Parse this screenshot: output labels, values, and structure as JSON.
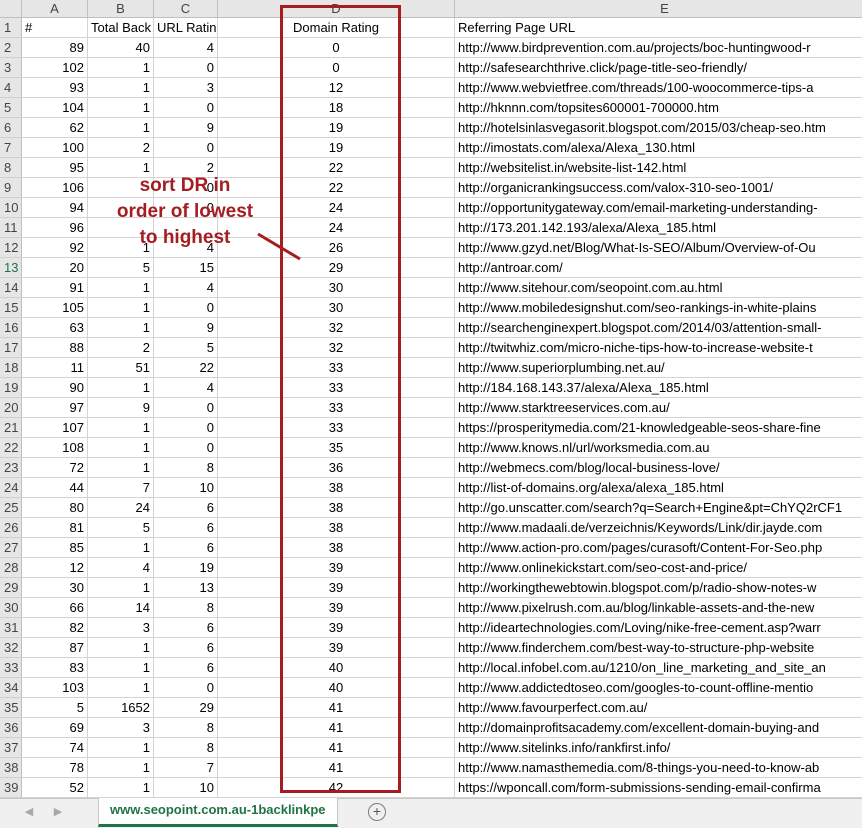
{
  "columns": [
    "A",
    "B",
    "C",
    "D",
    "E"
  ],
  "header_row": {
    "row_number": "1",
    "cells": [
      "#",
      "Total Back",
      "URL Rating",
      "Domain Rating",
      "Referring Page URL"
    ]
  },
  "rows": [
    {
      "n": "2",
      "a": "89",
      "b": "40",
      "c": "4",
      "d": "0",
      "e": "http://www.birdprevention.com.au/projects/boc-huntingwood-r"
    },
    {
      "n": "3",
      "a": "102",
      "b": "1",
      "c": "0",
      "d": "0",
      "e": "http://safesearchthrive.click/page-title-seo-friendly/"
    },
    {
      "n": "4",
      "a": "93",
      "b": "1",
      "c": "3",
      "d": "12",
      "e": "http://www.webvietfree.com/threads/100-woocommerce-tips-a"
    },
    {
      "n": "5",
      "a": "104",
      "b": "1",
      "c": "0",
      "d": "18",
      "e": "http://hknnn.com/topsites600001-700000.htm"
    },
    {
      "n": "6",
      "a": "62",
      "b": "1",
      "c": "9",
      "d": "19",
      "e": "http://hotelsinlasvegasorit.blogspot.com/2015/03/cheap-seo.htm"
    },
    {
      "n": "7",
      "a": "100",
      "b": "2",
      "c": "0",
      "d": "19",
      "e": "http://imostats.com/alexa/Alexa_130.html"
    },
    {
      "n": "8",
      "a": "95",
      "b": "1",
      "c": "2",
      "d": "22",
      "e": "http://websitelist.in/website-list-142.html"
    },
    {
      "n": "9",
      "a": "106",
      "b": "",
      "c": "0",
      "d": "22",
      "e": "http://organicrankingsuccess.com/valox-310-seo-1001/"
    },
    {
      "n": "10",
      "a": "94",
      "b": "",
      "c": "0",
      "d": "24",
      "e": "http://opportunitygateway.com/email-marketing-understanding-"
    },
    {
      "n": "11",
      "a": "96",
      "b": "",
      "c": "",
      "d": "24",
      "e": "http://173.201.142.193/alexa/Alexa_185.html"
    },
    {
      "n": "12",
      "a": "92",
      "b": "1",
      "c": "4",
      "d": "26",
      "e": "http://www.gzyd.net/Blog/What-Is-SEO/Album/Overview-of-Ou"
    },
    {
      "n": "13",
      "a": "20",
      "b": "5",
      "c": "15",
      "d": "29",
      "e": "http://antroar.com/"
    },
    {
      "n": "14",
      "a": "91",
      "b": "1",
      "c": "4",
      "d": "30",
      "e": "http://www.sitehour.com/seopoint.com.au.html"
    },
    {
      "n": "15",
      "a": "105",
      "b": "1",
      "c": "0",
      "d": "30",
      "e": "http://www.mobiledesignshut.com/seo-rankings-in-white-plains"
    },
    {
      "n": "16",
      "a": "63",
      "b": "1",
      "c": "9",
      "d": "32",
      "e": "http://searchenginexpert.blogspot.com/2014/03/attention-small-"
    },
    {
      "n": "17",
      "a": "88",
      "b": "2",
      "c": "5",
      "d": "32",
      "e": "http://twitwhiz.com/micro-niche-tips-how-to-increase-website-t"
    },
    {
      "n": "18",
      "a": "11",
      "b": "51",
      "c": "22",
      "d": "33",
      "e": "http://www.superiorplumbing.net.au/"
    },
    {
      "n": "19",
      "a": "90",
      "b": "1",
      "c": "4",
      "d": "33",
      "e": "http://184.168.143.37/alexa/Alexa_185.html"
    },
    {
      "n": "20",
      "a": "97",
      "b": "9",
      "c": "0",
      "d": "33",
      "e": "http://www.starktreeservices.com.au/"
    },
    {
      "n": "21",
      "a": "107",
      "b": "1",
      "c": "0",
      "d": "33",
      "e": "https://prosperitymedia.com/21-knowledgeable-seos-share-fine"
    },
    {
      "n": "22",
      "a": "108",
      "b": "1",
      "c": "0",
      "d": "35",
      "e": "http://www.knows.nl/url/worksmedia.com.au"
    },
    {
      "n": "23",
      "a": "72",
      "b": "1",
      "c": "8",
      "d": "36",
      "e": "http://webmecs.com/blog/local-business-love/"
    },
    {
      "n": "24",
      "a": "44",
      "b": "7",
      "c": "10",
      "d": "38",
      "e": "http://list-of-domains.org/alexa/alexa_185.html"
    },
    {
      "n": "25",
      "a": "80",
      "b": "24",
      "c": "6",
      "d": "38",
      "e": "http://go.unscatter.com/search?q=Search+Engine&pt=ChYQ2rCF1"
    },
    {
      "n": "26",
      "a": "81",
      "b": "5",
      "c": "6",
      "d": "38",
      "e": "http://www.madaali.de/verzeichnis/Keywords/Link/dir.jayde.com"
    },
    {
      "n": "27",
      "a": "85",
      "b": "1",
      "c": "6",
      "d": "38",
      "e": "http://www.action-pro.com/pages/curasoft/Content-For-Seo.php"
    },
    {
      "n": "28",
      "a": "12",
      "b": "4",
      "c": "19",
      "d": "39",
      "e": "http://www.onlinekickstart.com/seo-cost-and-price/"
    },
    {
      "n": "29",
      "a": "30",
      "b": "1",
      "c": "13",
      "d": "39",
      "e": "http://workingthewebtowin.blogspot.com/p/radio-show-notes-w"
    },
    {
      "n": "30",
      "a": "66",
      "b": "14",
      "c": "8",
      "d": "39",
      "e": "http://www.pixelrush.com.au/blog/linkable-assets-and-the-new"
    },
    {
      "n": "31",
      "a": "82",
      "b": "3",
      "c": "6",
      "d": "39",
      "e": "http://ideartechnologies.com/Loving/nike-free-cement.asp?warr"
    },
    {
      "n": "32",
      "a": "87",
      "b": "1",
      "c": "6",
      "d": "39",
      "e": "http://www.finderchem.com/best-way-to-structure-php-website"
    },
    {
      "n": "33",
      "a": "83",
      "b": "1",
      "c": "6",
      "d": "40",
      "e": "http://local.infobel.com.au/1210/on_line_marketing_and_site_an"
    },
    {
      "n": "34",
      "a": "103",
      "b": "1",
      "c": "0",
      "d": "40",
      "e": "http://www.addictedtoseo.com/googles-to-count-offline-mentio"
    },
    {
      "n": "35",
      "a": "5",
      "b": "1652",
      "c": "29",
      "d": "41",
      "e": "http://www.favourperfect.com.au/"
    },
    {
      "n": "36",
      "a": "69",
      "b": "3",
      "c": "8",
      "d": "41",
      "e": "http://domainprofitsacademy.com/excellent-domain-buying-and"
    },
    {
      "n": "37",
      "a": "74",
      "b": "1",
      "c": "8",
      "d": "41",
      "e": "http://www.sitelinks.info/rankfirst.info/"
    },
    {
      "n": "38",
      "a": "78",
      "b": "1",
      "c": "7",
      "d": "41",
      "e": "http://www.namasthemedia.com/8-things-you-need-to-know-ab"
    },
    {
      "n": "39",
      "a": "52",
      "b": "1",
      "c": "10",
      "d": "42",
      "e": "https://wponcall.com/form-submissions-sending-email-confirma"
    }
  ],
  "annotation": {
    "lines": [
      "sort DR in",
      "order of lowest",
      "to highest"
    ],
    "color": "#a51d21"
  },
  "sheet_tab": {
    "label": "www.seopoint.com.au-1backlinkpe"
  },
  "tab_nav": {
    "prev": "◀",
    "next": "▶",
    "add": "+"
  },
  "colors": {
    "accent": "#217346",
    "highlight": "#a51d21",
    "header_bg": "#e6e6e6"
  }
}
